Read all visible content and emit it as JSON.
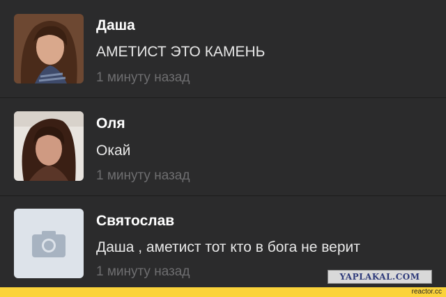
{
  "conversations": [
    {
      "name": "Даша",
      "message": "АМЕТИСТ ЭТО КАМЕНЬ",
      "time": "1 минуту назад",
      "avatar": "profile-photo"
    },
    {
      "name": "Оля",
      "message": "Окай",
      "time": "1 минуту назад",
      "avatar": "profile-photo"
    },
    {
      "name": "Святослав",
      "message": "Даша , аметист тот кто в бога не верит",
      "time": "1 минуту назад",
      "avatar": "camera-icon"
    }
  ],
  "watermark": "YAPLAKAL.COM",
  "footer": {
    "domain": "reactor.cc"
  },
  "colors": {
    "background": "#2b2b2c",
    "footer": "#fbd33a",
    "placeholder": "#dde3ea"
  }
}
